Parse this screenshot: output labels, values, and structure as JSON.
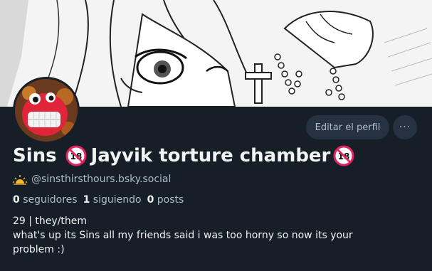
{
  "profile": {
    "name_part1": "Sins",
    "name_part2": "Jayvik torture chamber",
    "badge_text": "18",
    "status_icon": "sun-icon",
    "handle": "@sinsthirsthours.bsky.social",
    "followers_count": "0",
    "followers_label": "seguidores",
    "following_count": "1",
    "following_label": "siguiendo",
    "posts_count": "0",
    "posts_label": "posts",
    "bio_line1": "29 | they/them",
    "bio_line2": "what's up its Sins all my friends said i was too horny so now its your",
    "bio_line3": "problem :)"
  },
  "actions": {
    "edit_label": "Editar el perfil",
    "more_label": "···"
  },
  "colors": {
    "background": "#161e27",
    "button_bg": "#263242",
    "muted_text": "#aebbc9",
    "badge_red": "#e0245e"
  }
}
